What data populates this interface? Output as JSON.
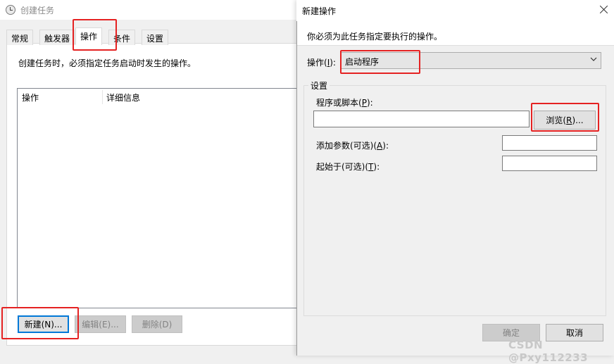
{
  "back_window": {
    "title": "创建任务",
    "tabs": [
      {
        "label": "常规"
      },
      {
        "label": "触发器"
      },
      {
        "label": "操作"
      },
      {
        "label": "条件"
      },
      {
        "label": "设置"
      }
    ],
    "description": "创建任务时，必须指定任务启动时发生的操作。",
    "list_columns": {
      "action": "操作",
      "detail": "详细信息"
    },
    "buttons": {
      "new": "新建(N)...",
      "edit": "编辑(E)...",
      "delete": "删除(D)"
    }
  },
  "dialog": {
    "title": "新建操作",
    "instruction": "你必须为此任务指定要执行的操作。",
    "action_label_prefix": "操作(",
    "action_label_key": "I",
    "action_label_suffix": "):",
    "action_value": "启动程序",
    "settings_legend": "设置",
    "program_label_prefix": "程序或脚本(",
    "program_label_key": "P",
    "program_label_suffix": "):",
    "program_value": "",
    "browse_prefix": "浏览(",
    "browse_key": "R",
    "browse_suffix": ")...",
    "args_label_prefix": "添加参数(可选)(",
    "args_label_key": "A",
    "args_label_suffix": "):",
    "args_value": "",
    "startin_label_prefix": "起始于(可选)(",
    "startin_label_key": "T",
    "startin_label_suffix": "):",
    "startin_value": "",
    "ok": "确定",
    "cancel": "取消"
  },
  "watermark": "CSDN @Pxy112233",
  "colors": {
    "highlight": "#e52222",
    "focus": "#0078d7"
  }
}
